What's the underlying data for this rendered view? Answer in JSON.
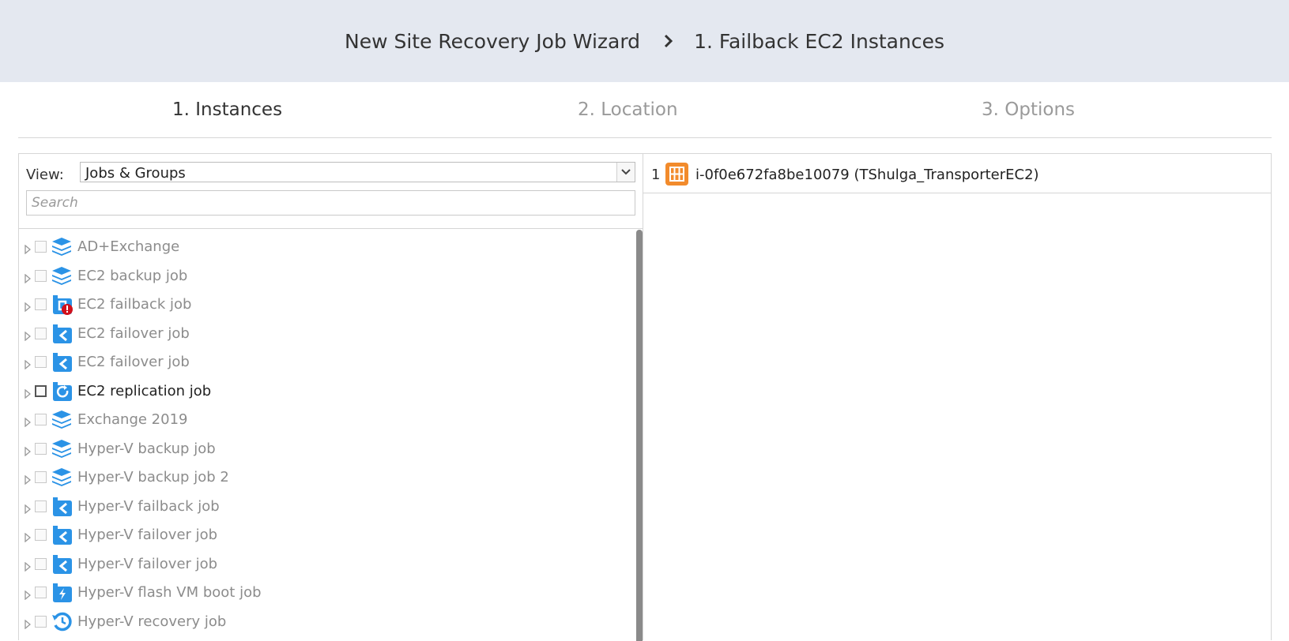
{
  "header": {
    "wizard_title": "New Site Recovery Job Wizard",
    "step_title": "1. Failback EC2 Instances"
  },
  "steps": [
    {
      "label": "1. Instances",
      "state": "active"
    },
    {
      "label": "2. Location",
      "state": "inactive"
    },
    {
      "label": "3. Options",
      "state": "inactive"
    }
  ],
  "left_pane": {
    "view_label": "View:",
    "view_value": "Jobs & Groups",
    "search_placeholder": "Search",
    "items": [
      {
        "label": "AD+Exchange",
        "icon": "backup-job-icon",
        "checked": false,
        "highlighted": false
      },
      {
        "label": "EC2 backup job",
        "icon": "backup-job-icon",
        "checked": false,
        "highlighted": false
      },
      {
        "label": "EC2 failback job",
        "icon": "failback-job-error-icon",
        "checked": false,
        "highlighted": false
      },
      {
        "label": "EC2 failover job",
        "icon": "failover-job-icon",
        "checked": false,
        "highlighted": false
      },
      {
        "label": "EC2 failover job",
        "icon": "failover-job-icon",
        "checked": false,
        "highlighted": false
      },
      {
        "label": "EC2 replication job",
        "icon": "replication-job-icon",
        "checked": false,
        "highlighted": true
      },
      {
        "label": "Exchange 2019",
        "icon": "backup-job-icon",
        "checked": false,
        "highlighted": false
      },
      {
        "label": "Hyper-V backup job",
        "icon": "backup-job-icon",
        "checked": false,
        "highlighted": false
      },
      {
        "label": "Hyper-V backup job 2",
        "icon": "backup-job-icon",
        "checked": false,
        "highlighted": false
      },
      {
        "label": "Hyper-V failback job",
        "icon": "failover-job-icon",
        "checked": false,
        "highlighted": false
      },
      {
        "label": "Hyper-V failover job",
        "icon": "failover-job-icon",
        "checked": false,
        "highlighted": false
      },
      {
        "label": "Hyper-V failover job",
        "icon": "failover-job-icon",
        "checked": false,
        "highlighted": false
      },
      {
        "label": "Hyper-V flash VM boot job",
        "icon": "flash-boot-job-icon",
        "checked": false,
        "highlighted": false
      },
      {
        "label": "Hyper-V recovery job",
        "icon": "recovery-job-icon",
        "checked": false,
        "highlighted": false
      }
    ]
  },
  "right_pane": {
    "selected_instances": [
      {
        "number": "1",
        "label": "i-0f0e672fa8be10079 (TShulga_TransporterEC2)",
        "icon": "ec2-instance-icon"
      }
    ]
  },
  "colors": {
    "header_bg": "#e4e8f0",
    "icon_blue": "#2b93e6",
    "instance_orange": "#f28b2c",
    "error_red": "#d0101b"
  }
}
